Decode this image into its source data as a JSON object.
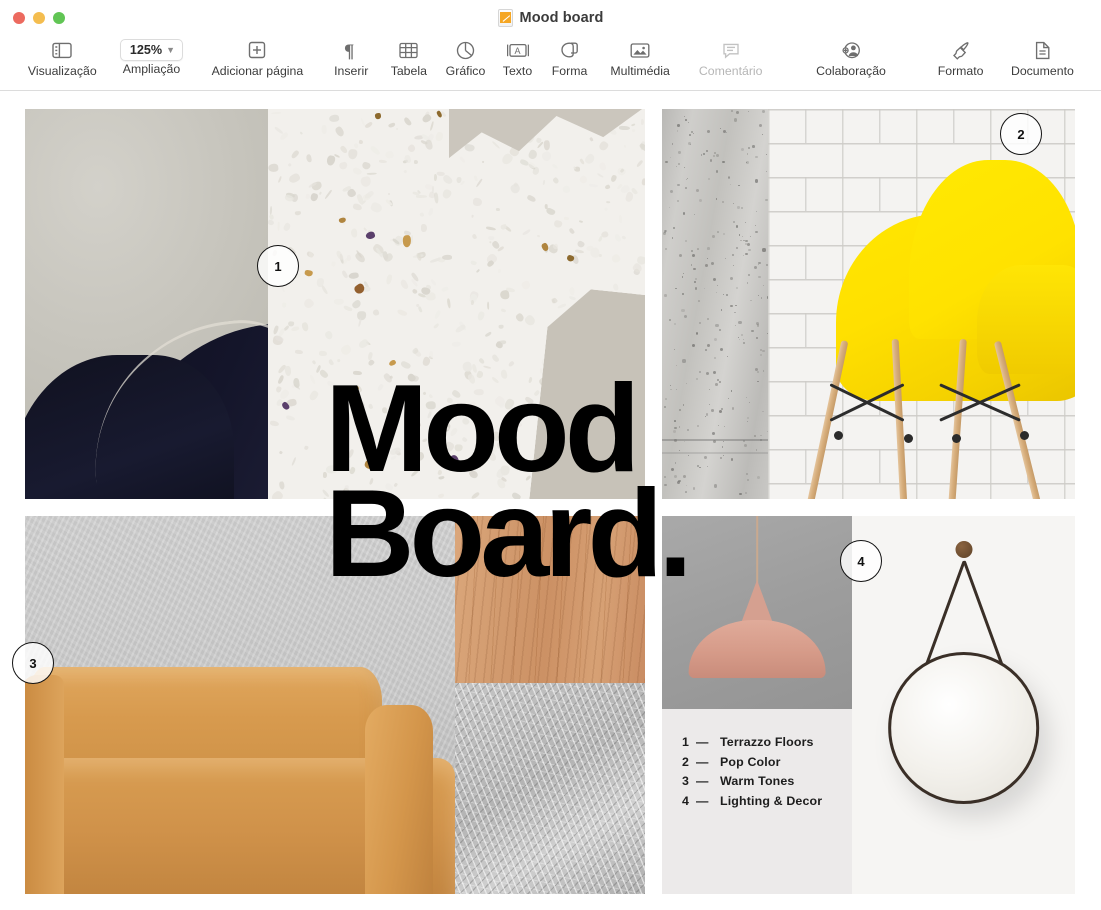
{
  "window": {
    "title": "Mood board",
    "doc_icon": "pages-document-icon",
    "traffic_lights": [
      {
        "name": "close",
        "color": "#ec6a5f"
      },
      {
        "name": "minimize",
        "color": "#f4bd4f"
      },
      {
        "name": "zoom",
        "color": "#61c554"
      }
    ]
  },
  "toolbar": {
    "items": [
      {
        "label": "Visualização",
        "icon": "view-sidebar-icon",
        "name": "view",
        "disabled": false
      },
      {
        "label": "Ampliação",
        "icon": "zoom-level-icon",
        "name": "zoom",
        "disabled": false,
        "value": "125%"
      },
      {
        "label": "Adicionar página",
        "icon": "add-page-icon",
        "name": "add-page",
        "disabled": false
      },
      {
        "label": "Inserir",
        "icon": "pilcrow-icon",
        "name": "insert",
        "disabled": false
      },
      {
        "label": "Tabela",
        "icon": "table-icon",
        "name": "table",
        "disabled": false
      },
      {
        "label": "Gráfico",
        "icon": "chart-pie-icon",
        "name": "chart",
        "disabled": false
      },
      {
        "label": "Texto",
        "icon": "text-box-icon",
        "name": "text",
        "disabled": false
      },
      {
        "label": "Forma",
        "icon": "shape-icon",
        "name": "shape",
        "disabled": false
      },
      {
        "label": "Multimédia",
        "icon": "media-image-icon",
        "name": "media",
        "disabled": false
      },
      {
        "label": "Comentário",
        "icon": "comment-bubble-icon",
        "name": "comment",
        "disabled": true
      },
      {
        "label": "Colaboração",
        "icon": "collaborate-person-icon",
        "name": "collaborate",
        "disabled": false
      },
      {
        "label": "Formato",
        "icon": "format-brush-icon",
        "name": "format",
        "disabled": false
      },
      {
        "label": "Documento",
        "icon": "document-page-icon",
        "name": "document",
        "disabled": false
      }
    ],
    "zoom_value": "125%",
    "zoom_chevron": "chevron-down-icon"
  },
  "document": {
    "headline": "Mood\nBoard.",
    "badges": [
      {
        "number": "1",
        "name": "badge-1-terrazzo"
      },
      {
        "number": "2",
        "name": "badge-2-pop-color"
      },
      {
        "number": "3",
        "name": "badge-3-warm-tones"
      },
      {
        "number": "4",
        "name": "badge-4-lighting-decor"
      }
    ],
    "legend": {
      "dash": "—",
      "rows": [
        {
          "num": "1",
          "text": "Terrazzo Floors"
        },
        {
          "num": "2",
          "text": "Pop Color"
        },
        {
          "num": "3",
          "text": "Warm Tones"
        },
        {
          "num": "4",
          "text": "Lighting & Decor"
        }
      ]
    },
    "images": [
      {
        "name": "image-navy-armchair",
        "alt": "Navy leather armchair on warm grey backdrop"
      },
      {
        "name": "image-white-terrazzo",
        "alt": "White terrazzo stone slab texture"
      },
      {
        "name": "image-concrete-wall",
        "alt": "Grey concrete wall texture strip"
      },
      {
        "name": "image-yellow-chair",
        "alt": "Yellow moulded chair against white brick wall"
      },
      {
        "name": "image-tan-leather-sofa",
        "alt": "Tan leather sofa against grey plaster wall"
      },
      {
        "name": "image-wood-grain",
        "alt": "Warm oak wood grain swatch"
      },
      {
        "name": "image-grey-fur-rug",
        "alt": "Grey shaggy fur rug texture"
      },
      {
        "name": "image-pink-pendant-lamp",
        "alt": "Blush pink pendant lamp on grey wall"
      },
      {
        "name": "image-round-mirror",
        "alt": "Round leather-strap mirror on white wall"
      }
    ]
  }
}
